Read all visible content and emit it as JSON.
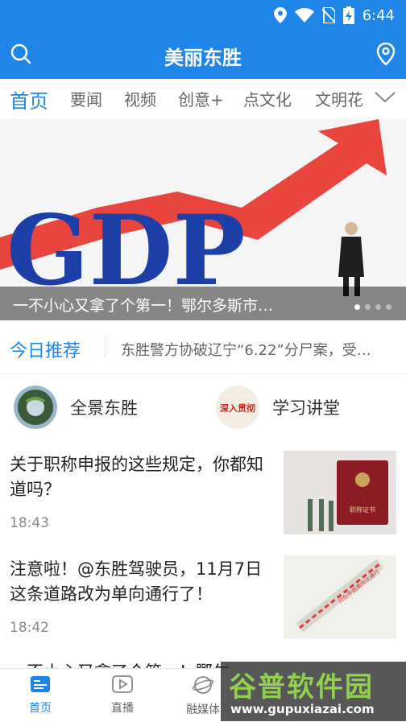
{
  "status": {
    "time": "6:44",
    "icons": [
      "location-icon",
      "wifi-icon",
      "no-sim-icon",
      "battery-charging-icon"
    ]
  },
  "app": {
    "title": "美丽东胜"
  },
  "tabs": [
    {
      "label": "首页",
      "active": true
    },
    {
      "label": "要闻"
    },
    {
      "label": "视频"
    },
    {
      "label": "创意+"
    },
    {
      "label": "点文化"
    },
    {
      "label": "文明花"
    }
  ],
  "banner": {
    "caption": "一不小心又拿了个第一！鄂尔多斯市…",
    "image_text": "GDP",
    "page_count": 4,
    "current_page": 1
  },
  "recommend": {
    "label": "今日推荐",
    "text": "东胜警方协破辽宁“6.22”分尸案，受…"
  },
  "quick_links": [
    {
      "label": "全景东胜",
      "icon": "panorama-globe-icon"
    },
    {
      "label": "学习讲堂",
      "icon": "study-logo-icon",
      "logo_text": "深入贯彻"
    }
  ],
  "news": [
    {
      "headline": "关于职称申报的这些规定，你都知道吗？",
      "time": "18:43",
      "thumb_text": "职称证书"
    },
    {
      "headline": "注意啦！@东胜驾驶员，11月7日这条道路改为单向通行了！",
      "time": "18:42",
      "thumb_text": "只允许由南向北通行"
    },
    {
      "headline": "一不小心又拿了个第一！鄂尔",
      "time": ""
    }
  ],
  "bottom_nav": [
    {
      "label": "首页",
      "active": true,
      "icon": "home-news-icon"
    },
    {
      "label": "直播",
      "icon": "play-icon"
    },
    {
      "label": "融媒体",
      "icon": "globe-icon"
    }
  ],
  "watermark": {
    "title": "谷普软件园",
    "url": "www.gupuxiazai.com"
  },
  "colors": {
    "primary": "#1f86e8",
    "red": "#e8322b",
    "text": "#222222"
  }
}
